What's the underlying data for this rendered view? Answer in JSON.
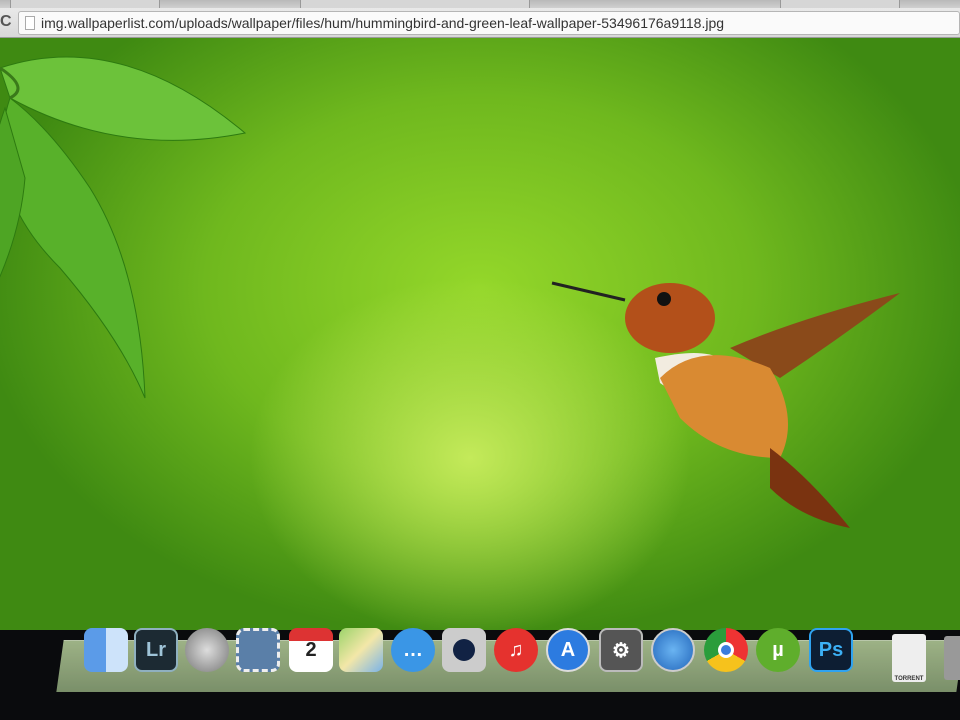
{
  "browser": {
    "url": "img.wallpaperlist.com/uploads/wallpaper/files/hum/hummingbird-and-green-leaf-wallpaper-53496176a9118.jpg",
    "reload_icon": "C"
  },
  "dock": {
    "items": [
      {
        "name": "finder",
        "label": ""
      },
      {
        "name": "lightroom",
        "label": "Lr"
      },
      {
        "name": "launchpad",
        "label": ""
      },
      {
        "name": "mail",
        "label": ""
      },
      {
        "name": "calendar",
        "label": "2"
      },
      {
        "name": "maps",
        "label": ""
      },
      {
        "name": "messages",
        "label": "…"
      },
      {
        "name": "facetime",
        "label": ""
      },
      {
        "name": "itunes",
        "label": "♫"
      },
      {
        "name": "app-store",
        "label": "A"
      },
      {
        "name": "system-preferences",
        "label": "⚙"
      },
      {
        "name": "safari",
        "label": ""
      },
      {
        "name": "chrome",
        "label": ""
      },
      {
        "name": "utorrent",
        "label": "µ"
      },
      {
        "name": "photoshop",
        "label": "Ps"
      },
      {
        "name": "torrent-file",
        "label": "TORRENT"
      },
      {
        "name": "trash",
        "label": ""
      }
    ]
  },
  "colors": {
    "bg_green": "#8fd22a",
    "dock": "#b7cf9b"
  }
}
